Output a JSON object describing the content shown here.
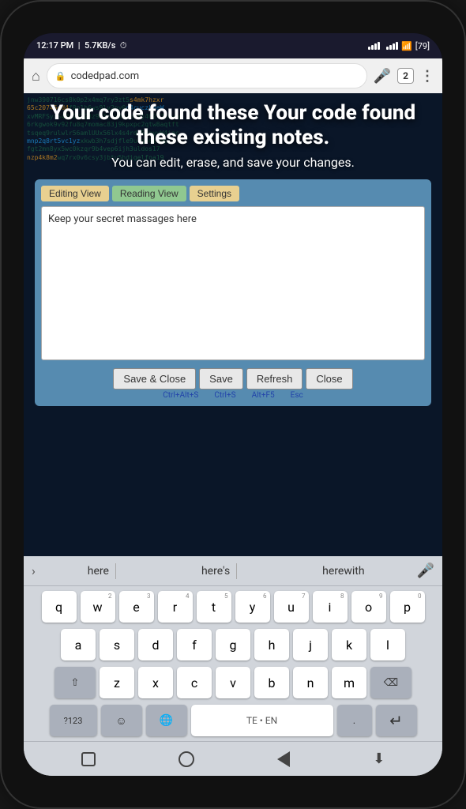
{
  "statusBar": {
    "time": "12:17 PM",
    "speed": "5.7KB/s",
    "battery": "79"
  },
  "browserBar": {
    "url": "codedpad.com",
    "tabCount": "2"
  },
  "hero": {
    "title": "Your code found these existing notes.",
    "subtitle": "You can edit, erase, and save your changes."
  },
  "editor": {
    "tabs": {
      "editing": "Editing View",
      "reading": "Reading View",
      "settings": "Settings"
    },
    "noteContent": "Keep your secret massages here",
    "buttons": {
      "saveClose": "Save & Close",
      "save": "Save",
      "refresh": "Refresh",
      "close": "Close"
    },
    "shortcuts": {
      "saveClose": "Ctrl+Alt+S",
      "save": "Ctrl+S",
      "refresh": "Alt+F5",
      "close": "Esc"
    }
  },
  "autocomplete": {
    "words": [
      "here",
      "here's",
      "herewith"
    ]
  },
  "keyboard": {
    "row1": [
      {
        "key": "q",
        "num": ""
      },
      {
        "key": "w",
        "num": "2"
      },
      {
        "key": "e",
        "num": "3"
      },
      {
        "key": "r",
        "num": "4"
      },
      {
        "key": "t",
        "num": "5"
      },
      {
        "key": "y",
        "num": "6"
      },
      {
        "key": "u",
        "num": "7"
      },
      {
        "key": "i",
        "num": "8"
      },
      {
        "key": "o",
        "num": "9"
      },
      {
        "key": "p",
        "num": "0"
      }
    ],
    "row2": [
      "a",
      "s",
      "d",
      "f",
      "g",
      "h",
      "j",
      "k",
      "l"
    ],
    "row3": [
      "z",
      "x",
      "c",
      "v",
      "b",
      "n",
      "m"
    ],
    "specialKeys": {
      "shift": "⇧",
      "backspace": "⌫",
      "numbers": "?123",
      "emoji": "☺",
      "globe": "🌐",
      "teLang": "TE • EN",
      "period": ".",
      "enter": "↵"
    }
  },
  "bottomNav": {
    "stop": "■",
    "home": "○",
    "back": "◁",
    "download": "⬇"
  },
  "codeBg": {
    "lines": [
      "jnw390716cs8k0p2x4mq7ry3zt5s4mk7hzxr",
      "65c20745ed4f8n1b6ws9lv2py0c4cuczkaeW",
      "xvMRFSyxS4DI2UTG3z95Tc xkkwnaxj462s72mwop",
      "6rkgwok9v92fu8q7momac83j9kpxpc2qtw8aqtft",
      "tsqeq9rulwlr56amlUUx56lx4s4rdi5dayvW4iac"
    ]
  }
}
